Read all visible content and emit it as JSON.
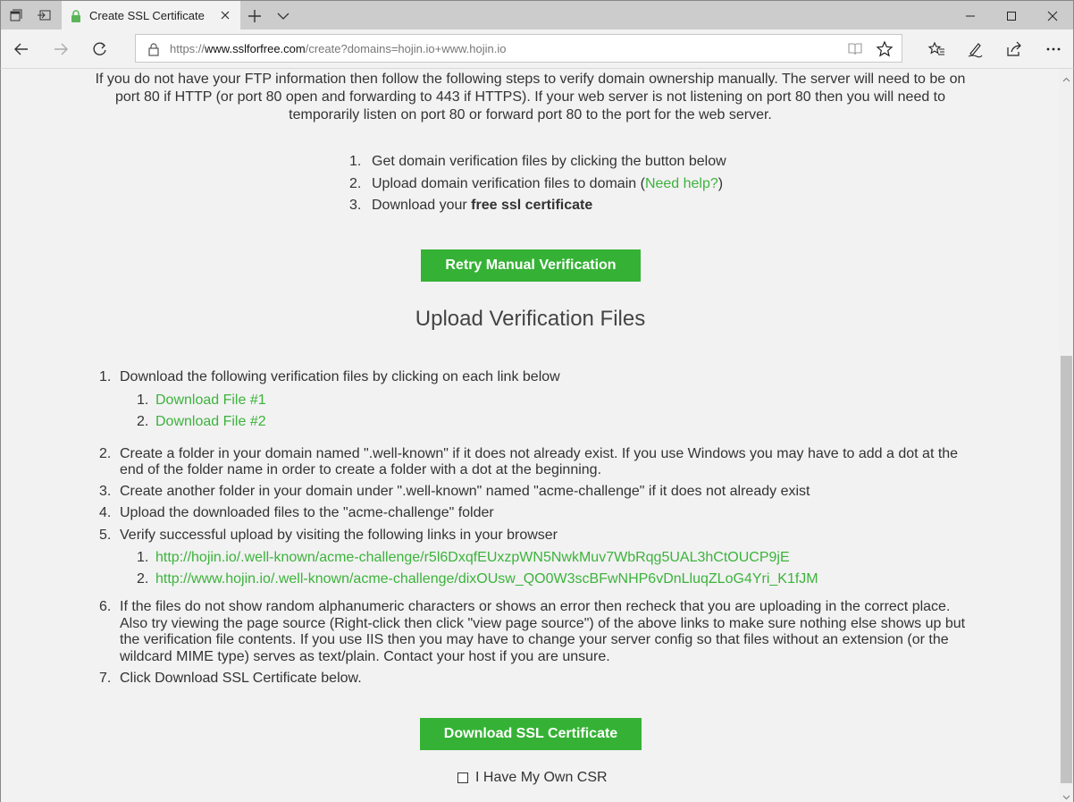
{
  "browser": {
    "tab_title": "Create SSL Certificate",
    "url_prefix": "https://",
    "url_domain": "www.sslforfree.com",
    "url_path": "/create?domains=hojin.io+www.hojin.io"
  },
  "page": {
    "intro": "If you do not have your FTP information then follow the following steps to verify domain ownership manually. The server will need to be on port 80 if HTTP (or port 80 open and forwarding to 443 if HTTPS). If your web server is not listening on port 80 then you will need to temporarily listen on port 80 or forward port 80 to the port for the web server.",
    "steps": {
      "s1_num": "1.",
      "s1": "Get domain verification files by clicking the button below",
      "s2_num": "2.",
      "s2_pre": "Upload domain verification files to domain (",
      "s2_link": "Need help?",
      "s2_post": ")",
      "s3_num": "3.",
      "s3_pre": "Download your ",
      "s3_bold": "free ssl certificate"
    },
    "retry_button": "Retry Manual Verification",
    "section_title": "Upload Verification Files",
    "upload": {
      "i1_num": "1.",
      "i1": "Download the following verification files by clicking on each link below",
      "f1_num": "1.",
      "f1": "Download File #1",
      "f2_num": "2.",
      "f2": "Download File #2",
      "i2_num": "2.",
      "i2": "Create a folder in your domain named \".well-known\" if it does not already exist. If you use Windows you may have to add a dot at the end of the folder name in order to create a folder with a dot at the beginning.",
      "i3_num": "3.",
      "i3": "Create another folder in your domain under \".well-known\" named \"acme-challenge\" if it does not already exist",
      "i4_num": "4.",
      "i4": "Upload the downloaded files to the \"acme-challenge\" folder",
      "i5_num": "5.",
      "i5": "Verify successful upload by visiting the following links in your browser",
      "l1_num": "1.",
      "l1": "http://hojin.io/.well-known/acme-challenge/r5l6DxqfEUxzpWN5NwkMuv7WbRqg5UAL3hCtOUCP9jE",
      "l2_num": "2.",
      "l2": "http://www.hojin.io/.well-known/acme-challenge/dixOUsw_QO0W3scBFwNHP6vDnLluqZLoG4Yri_K1fJM",
      "i6_num": "6.",
      "i6": "If the files do not show random alphanumeric characters or shows an error then recheck that you are uploading in the correct place. Also try viewing the page source (Right-click then click \"view page source\") of the above links to make sure nothing else shows up but the verification file contents. If you use IIS then you may have to change your server config so that files without an extension (or the wildcard MIME type) serves as text/plain. Contact your host if you are unsure.",
      "i7_num": "7.",
      "i7": "Click Download SSL Certificate below."
    },
    "download_button": "Download SSL Certificate",
    "csr_label": "I Have My Own CSR"
  },
  "colors": {
    "accent_green": "#35b235",
    "link_green": "#3cb33c"
  }
}
